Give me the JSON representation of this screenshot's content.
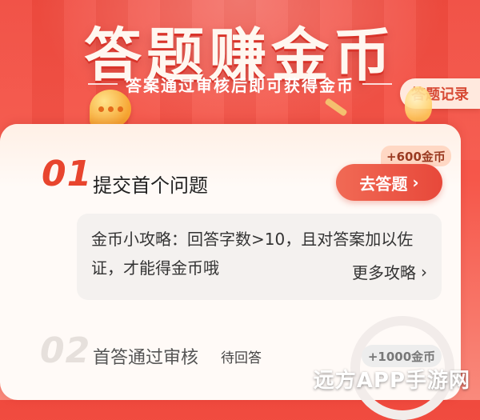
{
  "hero": {
    "title": "答题赚金币",
    "subtitle": "答案通过审核后即可获得金币",
    "records_label": "答题记录"
  },
  "steps": [
    {
      "number": "01",
      "title": "提交首个问题",
      "reward": "+600金币",
      "action_label": "去答题",
      "tips_text": "金币小攻略：回答字数>10，且对答案加以佐证，才能得金币哦",
      "tips_more_label": "更多攻略"
    },
    {
      "number": "02",
      "title": "首答通过审核",
      "status": "待回答",
      "reward": "+1000金币"
    }
  ],
  "watermark": "远方APP手游网",
  "colors": {
    "background": "#f04a3e",
    "accent": "#e8452e",
    "card": "#fffaf7",
    "badge": "#ffd8c4"
  },
  "icons": [
    "speech-bubble-icon",
    "chevron-right-icon",
    "coin-icon",
    "lightbulb-icon"
  ]
}
